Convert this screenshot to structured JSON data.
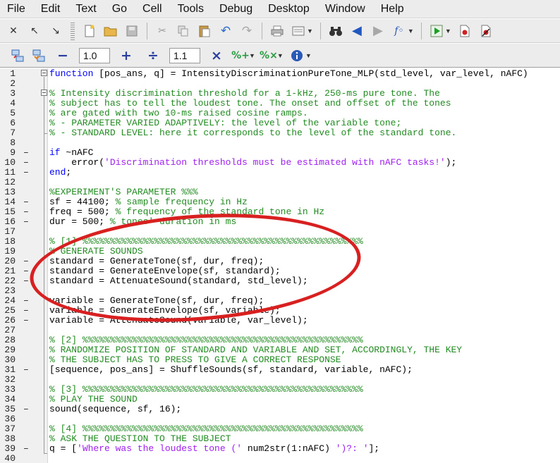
{
  "menubar": {
    "items": [
      "File",
      "Edit",
      "Text",
      "Go",
      "Cell",
      "Tools",
      "Debug",
      "Desktop",
      "Window",
      "Help"
    ]
  },
  "toolbar2": {
    "decrement_label": "−",
    "decrement_value": "1.0",
    "increment_label": "+",
    "divide_label": "÷",
    "divide_value": "1.1",
    "multiply_label": "×"
  },
  "colors": {
    "keyword": "#0000ff",
    "comment": "#228b22",
    "string": "#a020f0",
    "annotation_ellipse": "#d82020"
  },
  "editor": {
    "lines": [
      {
        "n": "1",
        "mark": "",
        "segs": [
          {
            "c": "kw",
            "t": "function"
          },
          {
            "c": "tx",
            "t": " [pos_ans, q] = IntensityDiscriminationPureTone_MLP(std_level, var_level, nAFC)"
          }
        ]
      },
      {
        "n": "2",
        "mark": "",
        "segs": []
      },
      {
        "n": "3",
        "mark": "",
        "segs": [
          {
            "c": "cm",
            "t": "% Intensity discrimination threshold for a 1-kHz, 250-ms pure tone. The"
          }
        ]
      },
      {
        "n": "4",
        "mark": "",
        "segs": [
          {
            "c": "cm",
            "t": "% subject has to tell the loudest tone. The onset and offset of the tones"
          }
        ]
      },
      {
        "n": "5",
        "mark": "",
        "segs": [
          {
            "c": "cm",
            "t": "% are gated with two 10-ms raised cosine ramps."
          }
        ]
      },
      {
        "n": "6",
        "mark": "",
        "segs": [
          {
            "c": "cm",
            "t": "% - PARAMETER VARIED ADAPTIVELY: the level of the variable tone;"
          }
        ]
      },
      {
        "n": "7",
        "mark": "",
        "segs": [
          {
            "c": "cm",
            "t": "% - STANDARD LEVEL: here it corresponds to the level of the standard tone."
          }
        ]
      },
      {
        "n": "8",
        "mark": "",
        "segs": []
      },
      {
        "n": "9",
        "mark": "–",
        "segs": [
          {
            "c": "kw",
            "t": "if"
          },
          {
            "c": "tx",
            "t": " ~nAFC"
          }
        ]
      },
      {
        "n": "10",
        "mark": "–",
        "segs": [
          {
            "c": "tx",
            "t": "    error("
          },
          {
            "c": "st",
            "t": "'Discrimination thresholds must be estimated with nAFC tasks!'"
          },
          {
            "c": "tx",
            "t": ");"
          }
        ]
      },
      {
        "n": "11",
        "mark": "–",
        "segs": [
          {
            "c": "kw",
            "t": "end"
          },
          {
            "c": "tx",
            "t": ";"
          }
        ]
      },
      {
        "n": "12",
        "mark": "",
        "segs": []
      },
      {
        "n": "13",
        "mark": "",
        "segs": [
          {
            "c": "cm",
            "t": "%EXPERIMENT'S PARAMETER %%%"
          }
        ]
      },
      {
        "n": "14",
        "mark": "–",
        "segs": [
          {
            "c": "tx",
            "t": "sf = 44100; "
          },
          {
            "c": "cm",
            "t": "% sample frequency in Hz"
          }
        ]
      },
      {
        "n": "15",
        "mark": "–",
        "segs": [
          {
            "c": "tx",
            "t": "freq = 500; "
          },
          {
            "c": "cm",
            "t": "% frequency of the standard tone in Hz"
          }
        ]
      },
      {
        "n": "16",
        "mark": "–",
        "segs": [
          {
            "c": "tx",
            "t": "dur = 500; "
          },
          {
            "c": "cm",
            "t": "% tones' duration in ms"
          }
        ]
      },
      {
        "n": "17",
        "mark": "",
        "segs": []
      },
      {
        "n": "18",
        "mark": "",
        "segs": [
          {
            "c": "cm",
            "t": "% [1] %%%%%%%%%%%%%%%%%%%%%%%%%%%%%%%%%%%%%%%%%%%%%%%%%%%"
          }
        ]
      },
      {
        "n": "19",
        "mark": "",
        "segs": [
          {
            "c": "cm",
            "t": "% GENERATE SOUNDS"
          }
        ]
      },
      {
        "n": "20",
        "mark": "–",
        "segs": [
          {
            "c": "tx",
            "t": "standard = GenerateTone(sf, dur, freq);"
          }
        ]
      },
      {
        "n": "21",
        "mark": "–",
        "segs": [
          {
            "c": "tx",
            "t": "standard = GenerateEnvelope(sf, standard);"
          }
        ]
      },
      {
        "n": "22",
        "mark": "–",
        "segs": [
          {
            "c": "tx",
            "t": "standard = AttenuateSound(standard, std_level);"
          }
        ]
      },
      {
        "n": "23",
        "mark": "",
        "segs": []
      },
      {
        "n": "24",
        "mark": "–",
        "segs": [
          {
            "c": "tx",
            "t": "variable = GenerateTone(sf, dur, freq);"
          }
        ]
      },
      {
        "n": "25",
        "mark": "–",
        "segs": [
          {
            "c": "tx",
            "t": "variable = GenerateEnvelope(sf, variable);"
          }
        ]
      },
      {
        "n": "26",
        "mark": "–",
        "segs": [
          {
            "c": "tx",
            "t": "variable = AttenuateSound(variable, var_level);"
          }
        ]
      },
      {
        "n": "27",
        "mark": "",
        "segs": []
      },
      {
        "n": "28",
        "mark": "",
        "segs": [
          {
            "c": "cm",
            "t": "% [2] %%%%%%%%%%%%%%%%%%%%%%%%%%%%%%%%%%%%%%%%%%%%%%%%%%%"
          }
        ]
      },
      {
        "n": "29",
        "mark": "",
        "segs": [
          {
            "c": "cm",
            "t": "% RANDOMIZE POSITION OF STANDARD AND VARIABLE AND SET, ACCORDINGLY, THE KEY"
          }
        ]
      },
      {
        "n": "30",
        "mark": "",
        "segs": [
          {
            "c": "cm",
            "t": "% THE SUBJECT HAS TO PRESS TO GIVE A CORRECT RESPONSE"
          }
        ]
      },
      {
        "n": "31",
        "mark": "–",
        "segs": [
          {
            "c": "tx",
            "t": "[sequence, pos_ans] = ShuffleSounds(sf, standard, variable, nAFC);"
          }
        ]
      },
      {
        "n": "32",
        "mark": "",
        "segs": []
      },
      {
        "n": "33",
        "mark": "",
        "segs": [
          {
            "c": "cm",
            "t": "% [3] %%%%%%%%%%%%%%%%%%%%%%%%%%%%%%%%%%%%%%%%%%%%%%%%%%%"
          }
        ]
      },
      {
        "n": "34",
        "mark": "",
        "segs": [
          {
            "c": "cm",
            "t": "% PLAY THE SOUND"
          }
        ]
      },
      {
        "n": "35",
        "mark": "–",
        "segs": [
          {
            "c": "tx",
            "t": "sound(sequence, sf, 16);"
          }
        ]
      },
      {
        "n": "36",
        "mark": "",
        "segs": []
      },
      {
        "n": "37",
        "mark": "",
        "segs": [
          {
            "c": "cm",
            "t": "% [4] %%%%%%%%%%%%%%%%%%%%%%%%%%%%%%%%%%%%%%%%%%%%%%%%%%%"
          }
        ]
      },
      {
        "n": "38",
        "mark": "",
        "segs": [
          {
            "c": "cm",
            "t": "% ASK THE QUESTION TO THE SUBJECT"
          }
        ]
      },
      {
        "n": "39",
        "mark": "–",
        "segs": [
          {
            "c": "tx",
            "t": "q = ["
          },
          {
            "c": "st",
            "t": "'Where was the loudest tone ('"
          },
          {
            "c": "tx",
            "t": " num2str(1:nAFC) "
          },
          {
            "c": "st",
            "t": "')?: '"
          },
          {
            "c": "tx",
            "t": "];"
          }
        ]
      },
      {
        "n": "40",
        "mark": "",
        "segs": []
      }
    ]
  }
}
